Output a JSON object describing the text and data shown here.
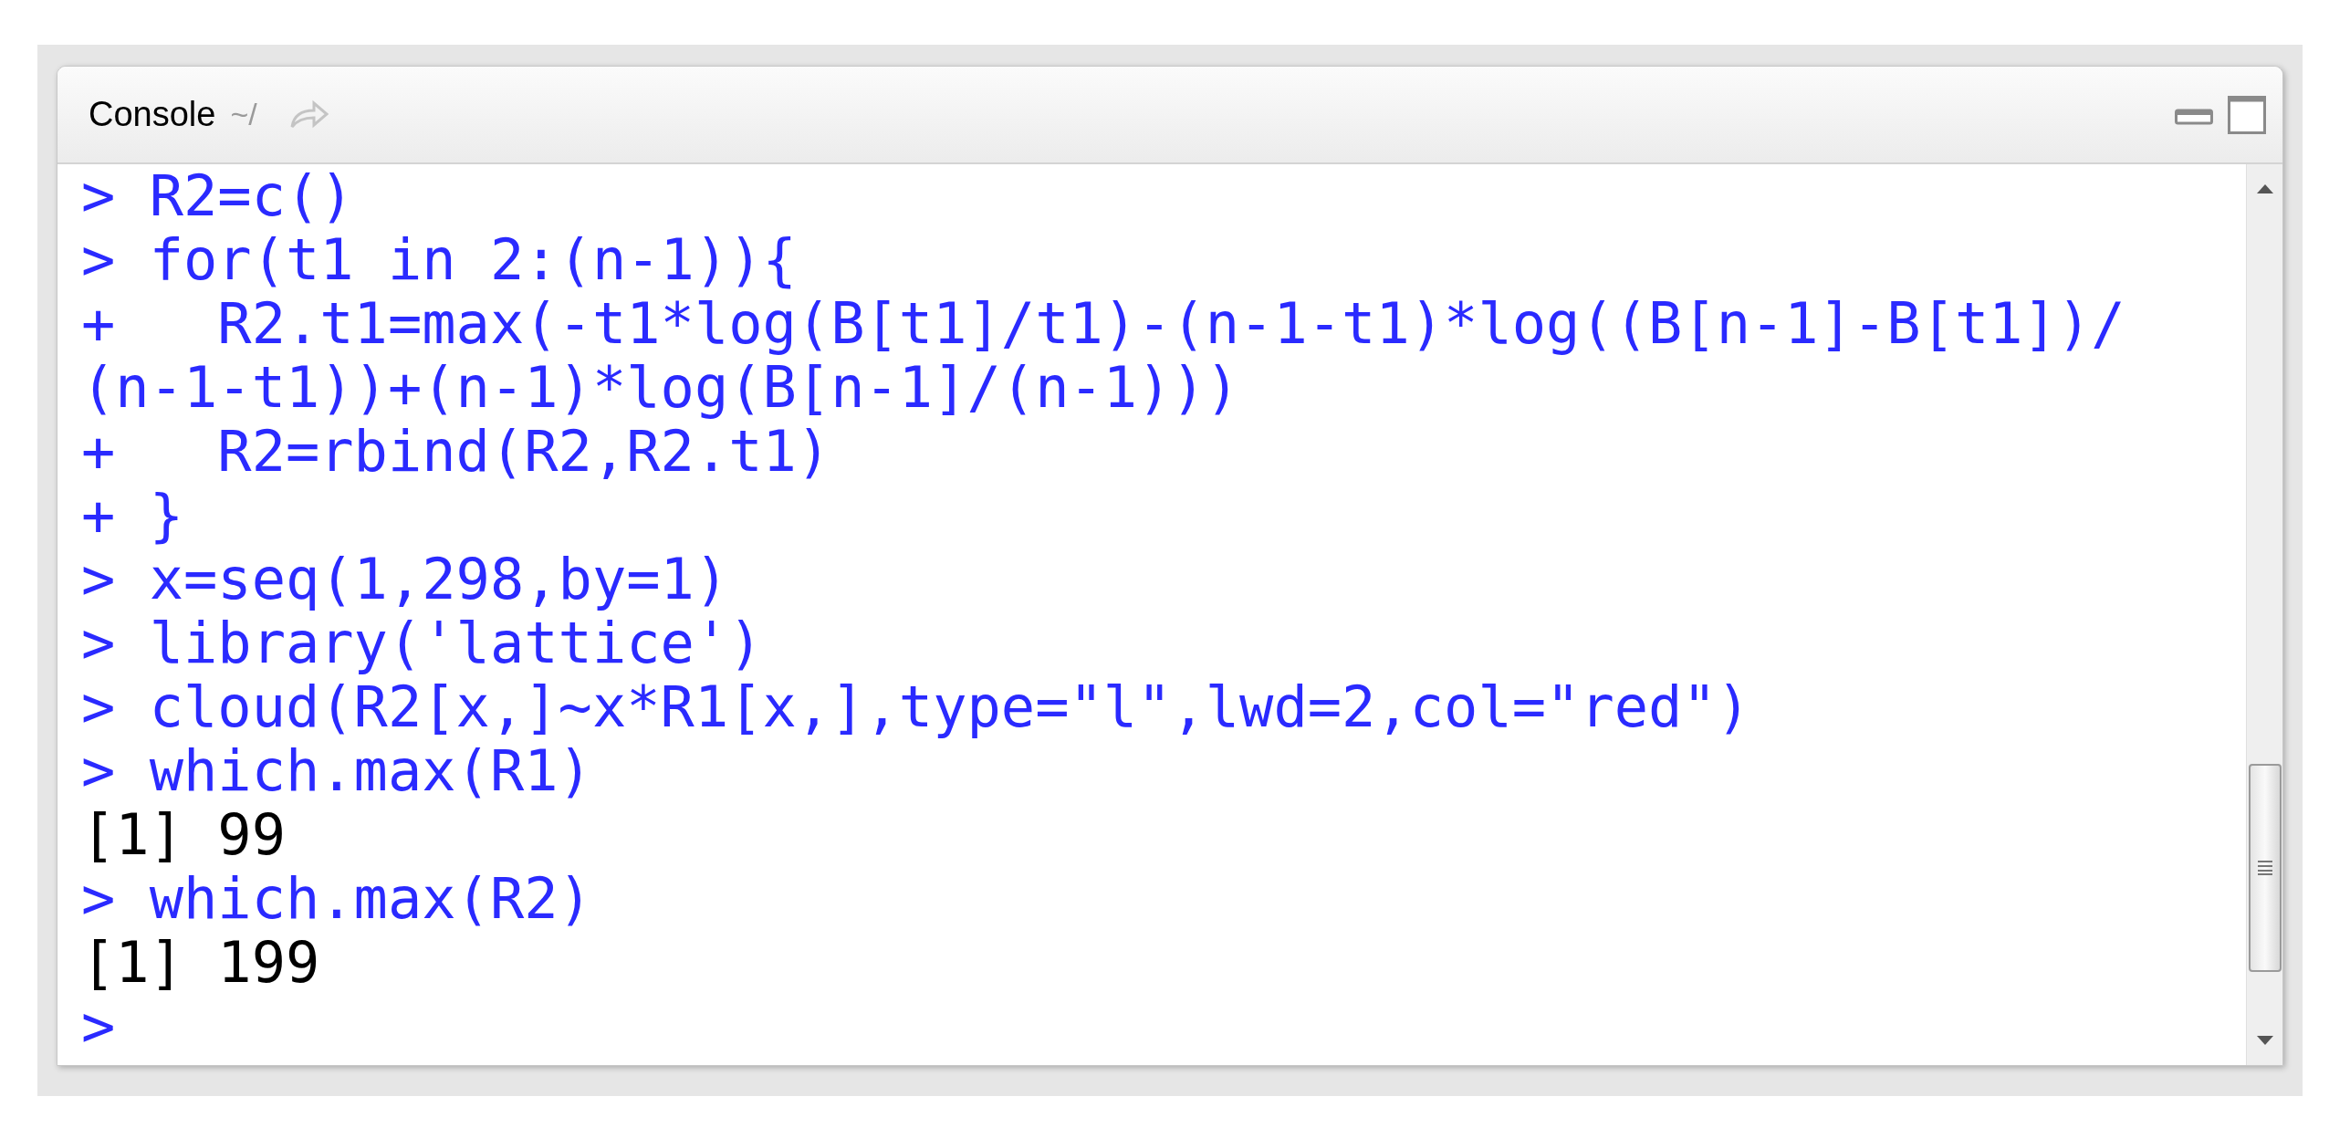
{
  "pane": {
    "title": "Console",
    "path": "~/"
  },
  "lines": [
    {
      "kind": "input",
      "text": "> R2=c()"
    },
    {
      "kind": "input",
      "text": "> for(t1 in 2:(n-1)){"
    },
    {
      "kind": "input",
      "text": "+   R2.t1=max(-t1*log(B[t1]/t1)-(n-1-t1)*log((B[n-1]-B[t1])/"
    },
    {
      "kind": "input",
      "text": "(n-1-t1))+(n-1)*log(B[n-1]/(n-1)))"
    },
    {
      "kind": "input",
      "text": "+   R2=rbind(R2,R2.t1)"
    },
    {
      "kind": "input",
      "text": "+ }"
    },
    {
      "kind": "input",
      "text": "> x=seq(1,298,by=1)"
    },
    {
      "kind": "input",
      "text": "> library('lattice')"
    },
    {
      "kind": "input",
      "text": "> cloud(R2[x,]~x*R1[x,],type=\"l\",lwd=2,col=\"red\")"
    },
    {
      "kind": "input",
      "text": "> which.max(R1)"
    },
    {
      "kind": "output",
      "text": "[1] 99"
    },
    {
      "kind": "input",
      "text": "> which.max(R2)"
    },
    {
      "kind": "output",
      "text": "[1] 199"
    },
    {
      "kind": "input",
      "text": ">"
    }
  ]
}
